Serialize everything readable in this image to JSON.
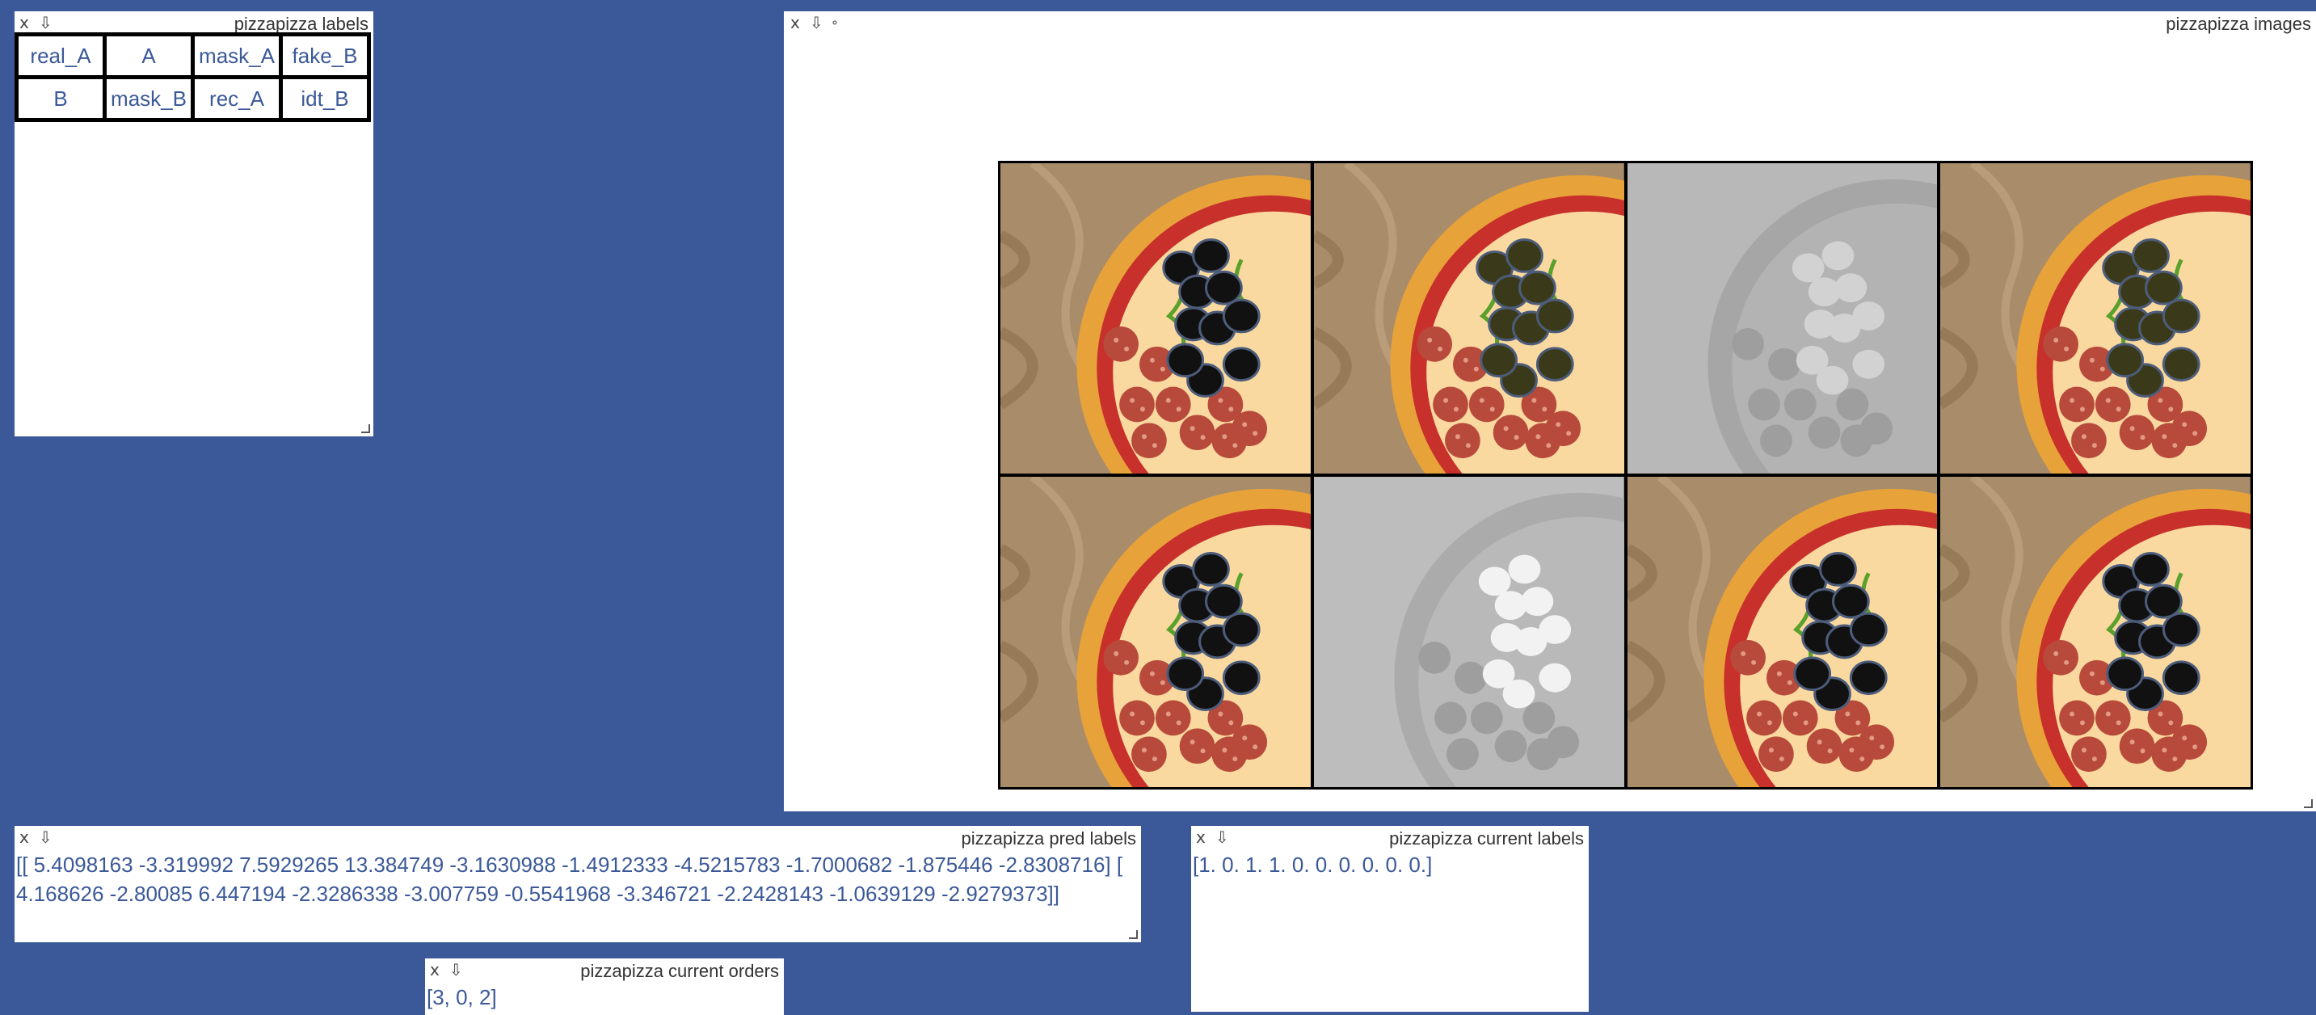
{
  "panes": {
    "labels": {
      "title": "pizzapizza labels",
      "close": "x",
      "download": "⇩",
      "rows": [
        [
          "real_A",
          "A",
          "mask_A",
          "fake_B"
        ],
        [
          "B",
          "mask_B",
          "rec_A",
          "idt_B"
        ]
      ]
    },
    "images": {
      "title": "pizzapizza images",
      "close": "x",
      "download": "⇩",
      "extra": "∘",
      "tiles": [
        {
          "name": "real_A",
          "variant": "color"
        },
        {
          "name": "A",
          "variant": "color-dark"
        },
        {
          "name": "mask_A",
          "variant": "gray"
        },
        {
          "name": "fake_B",
          "variant": "color-dark"
        },
        {
          "name": "B",
          "variant": "color"
        },
        {
          "name": "mask_B",
          "variant": "gray-soft"
        },
        {
          "name": "rec_A",
          "variant": "color"
        },
        {
          "name": "idt_B",
          "variant": "color"
        }
      ]
    },
    "pred_labels": {
      "title": "pizzapizza pred labels",
      "close": "x",
      "download": "⇩",
      "text": "[[ 5.4098163 -3.319992 7.5929265 13.384749 -3.1630988 -1.4912333 -4.5215783 -1.7000682 -1.875446 -2.8308716] [ 4.168626 -2.80085 6.447194 -2.3286338 -3.007759 -0.5541968 -3.346721 -2.2428143 -1.0639129 -2.9279373]]"
    },
    "current_labels": {
      "title": "pizzapizza current labels",
      "close": "x",
      "download": "⇩",
      "text": "[1. 0. 1. 1. 0. 0. 0. 0. 0. 0.]"
    },
    "current_orders": {
      "title": "pizzapizza current orders",
      "close": "x",
      "download": "⇩",
      "text": "[3, 0, 2]"
    }
  },
  "colors": {
    "background": "#3b5998",
    "text_accent": "#3b5998",
    "pane": "#ffffff",
    "wood": "#a98c6a",
    "crust": "#e8a23a",
    "sauce": "#c8302b",
    "cheese": "#f9d9a0",
    "pepperoni": "#b84a3c",
    "olive": "#111111",
    "pepper": "#5aa02c"
  }
}
